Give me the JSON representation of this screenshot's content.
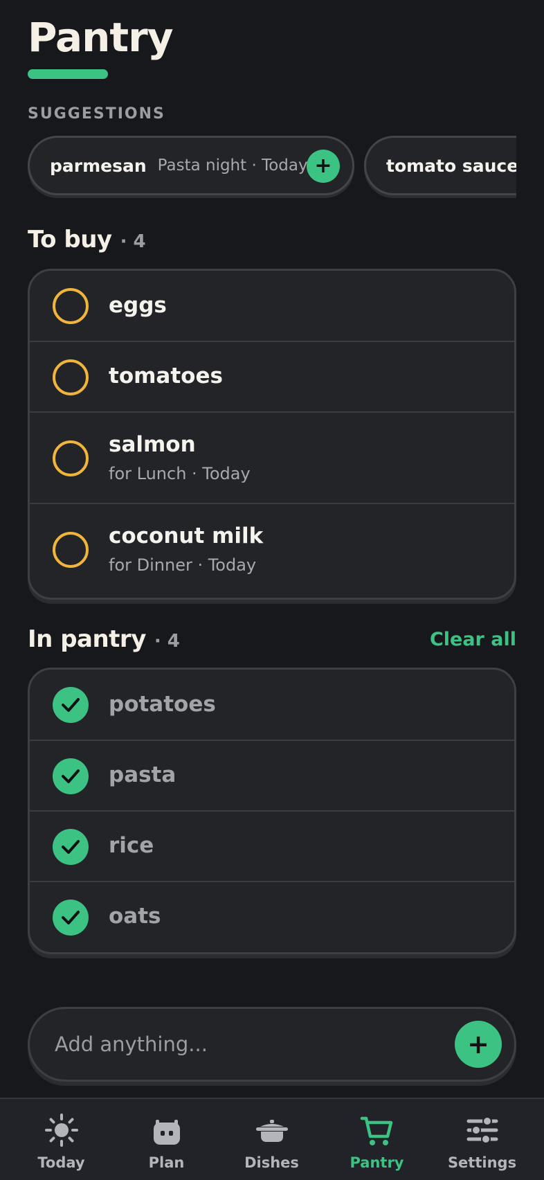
{
  "header": {
    "title": "Pantry"
  },
  "suggestions": {
    "label": "SUGGESTIONS",
    "items": [
      {
        "name": "parmesan",
        "meta": "Pasta night · Today",
        "add_icon": "plus-icon"
      },
      {
        "name": "tomato sauce"
      }
    ]
  },
  "to_buy": {
    "title": "To buy",
    "count": "· 4",
    "items": [
      {
        "name": "eggs"
      },
      {
        "name": "tomatoes"
      },
      {
        "name": "salmon",
        "sub": "for Lunch · Today"
      },
      {
        "name": "coconut milk",
        "sub": "for Dinner · Today"
      }
    ]
  },
  "in_pantry": {
    "title": "In pantry",
    "count": "· 4",
    "clear_label": "Clear all",
    "items": [
      {
        "name": "potatoes"
      },
      {
        "name": "pasta"
      },
      {
        "name": "rice"
      },
      {
        "name": "oats"
      }
    ]
  },
  "add": {
    "placeholder": "Add anything...",
    "value": "",
    "button_icon": "plus-icon"
  },
  "nav": {
    "items": [
      {
        "label": "Today",
        "icon": "sun-icon"
      },
      {
        "label": "Plan",
        "icon": "robot-icon"
      },
      {
        "label": "Dishes",
        "icon": "pot-icon"
      },
      {
        "label": "Pantry",
        "icon": "cart-icon",
        "active": true
      },
      {
        "label": "Settings",
        "icon": "sliders-icon"
      }
    ]
  },
  "colors": {
    "background": "#17181c",
    "card": "#232428",
    "accent": "#3cc283",
    "pending": "#f1b53c",
    "muted": "#9c9da3"
  }
}
